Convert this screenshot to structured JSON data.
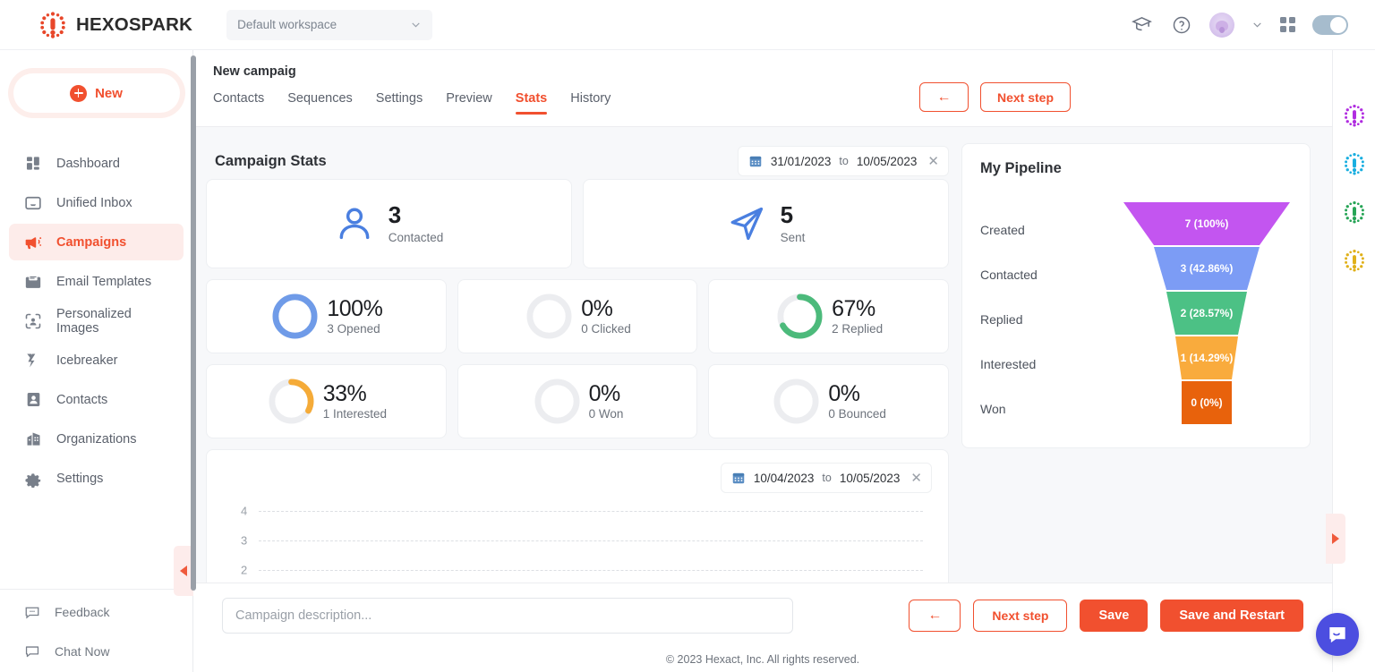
{
  "brand": {
    "name": "HEXOSPARK",
    "accent": "#f1502f",
    "logo_icon": "hexospark-dots-logo"
  },
  "topbar": {
    "workspace": {
      "label": "Default workspace",
      "chevron_icon": "chevron-down-icon"
    },
    "icons": [
      {
        "name": "academy-cap-icon"
      },
      {
        "name": "help-circle-icon"
      },
      {
        "name": "avatar"
      },
      {
        "name": "chevron-down-icon"
      },
      {
        "name": "apps-grid-icon"
      },
      {
        "name": "theme-toggle"
      }
    ]
  },
  "sidebar": {
    "new_button": {
      "label": "New",
      "icon": "plus-circle-icon"
    },
    "items": [
      {
        "label": "Dashboard",
        "icon": "dashboard-icon",
        "active": false
      },
      {
        "label": "Unified Inbox",
        "icon": "inbox-icon",
        "active": false
      },
      {
        "label": "Campaigns",
        "icon": "megaphone-icon",
        "active": true
      },
      {
        "label": "Email Templates",
        "icon": "email-template-icon",
        "active": false
      },
      {
        "label": "Personalized Images",
        "icon": "personalized-image-icon",
        "active": false
      },
      {
        "label": "Icebreaker",
        "icon": "icebreaker-icon",
        "active": false
      },
      {
        "label": "Contacts",
        "icon": "contact-card-icon",
        "active": false
      },
      {
        "label": "Organizations",
        "icon": "organization-icon",
        "active": false
      },
      {
        "label": "Settings",
        "icon": "gear-icon",
        "active": false
      }
    ],
    "bottom_items": [
      {
        "label": "Feedback",
        "icon": "feedback-icon"
      },
      {
        "label": "Chat Now",
        "icon": "chat-icon"
      }
    ],
    "collapse_icon": "collapse-left-icon"
  },
  "campaign": {
    "title": "New campaig",
    "tabs": [
      {
        "label": "Contacts",
        "active": false
      },
      {
        "label": "Sequences",
        "active": false
      },
      {
        "label": "Settings",
        "active": false
      },
      {
        "label": "Preview",
        "active": false
      },
      {
        "label": "Stats",
        "active": true
      },
      {
        "label": "History",
        "active": false
      }
    ],
    "header_actions": {
      "back_label": "←",
      "next_label": "Next step"
    }
  },
  "stats": {
    "panel_title": "Campaign Stats",
    "date_range": {
      "calendar_icon": "calendar-icon",
      "from": "31/01/2023",
      "to_label": "to",
      "to": "10/05/2023",
      "clear_icon": "close-icon"
    },
    "big_cards": [
      {
        "icon": "person-icon",
        "value": "3",
        "label": "Contacted",
        "color": "#4a7fe0"
      },
      {
        "icon": "send-icon",
        "value": "5",
        "label": "Sent",
        "color": "#3b6fe0"
      }
    ],
    "donuts": [
      {
        "pct": "100%",
        "label": "3 Opened",
        "value": 100,
        "color": "#6f9be8"
      },
      {
        "pct": "0%",
        "label": "0 Clicked",
        "value": 0,
        "color": "#e9ebee"
      },
      {
        "pct": "67%",
        "label": "2 Replied",
        "value": 67,
        "color": "#4cba7b"
      },
      {
        "pct": "33%",
        "label": "1 Interested",
        "value": 33,
        "color": "#f5ab38"
      },
      {
        "pct": "0%",
        "label": "0 Won",
        "value": 0,
        "color": "#e9ebee"
      },
      {
        "pct": "0%",
        "label": "0 Bounced",
        "value": 0,
        "color": "#e9ebee"
      }
    ]
  },
  "chart_data": {
    "type": "line",
    "title": "",
    "xlabel": "",
    "ylabel": "",
    "yticks": [
      "4",
      "3",
      "2"
    ],
    "ylim": [
      0,
      4
    ],
    "grid": true,
    "series": [],
    "x": [],
    "date_range": {
      "calendar_icon": "calendar-icon",
      "from": "10/04/2023",
      "to_label": "to",
      "to": "10/05/2023",
      "clear_icon": "close-icon"
    },
    "note": "Chart body is clipped below the viewport; only y-axis ticks 4, 3, 2 and dashed gridlines are visible."
  },
  "pipeline": {
    "title": "My Pipeline",
    "chart_data": {
      "type": "funnel",
      "title": "My Pipeline",
      "categories": [
        "Created",
        "Contacted",
        "Replied",
        "Interested",
        "Won"
      ],
      "values": [
        7,
        3,
        2,
        1,
        0
      ],
      "percents": [
        100,
        42.86,
        28.57,
        14.29,
        0
      ],
      "labels": [
        "7 (100%)",
        "3 (42.86%)",
        "2 (28.57%)",
        "1 (14.29%)",
        "0 (0%)"
      ],
      "colors": [
        "#c355f0",
        "#7c9cf5",
        "#4cc185",
        "#f9ab3d",
        "#e8620c"
      ]
    }
  },
  "bottombar": {
    "description_placeholder": "Campaign description...",
    "description_value": "",
    "back_label": "←",
    "next_label": "Next step",
    "save_label": "Save",
    "save_restart_label": "Save and Restart"
  },
  "footer": {
    "text": "© 2023 Hexact, Inc. All rights reserved."
  },
  "rightrail": {
    "apps": [
      {
        "name": "hexomatic-app-icon",
        "color": "#b02ce0"
      },
      {
        "name": "hexowatch-app-icon",
        "color": "#18aee0"
      },
      {
        "name": "hexometer-app-icon",
        "color": "#25a455"
      },
      {
        "name": "hexofy-app-icon",
        "color": "#e0b018"
      }
    ],
    "expand_icon": "expand-right-icon",
    "chat_icon": "intercom-chat-icon"
  }
}
